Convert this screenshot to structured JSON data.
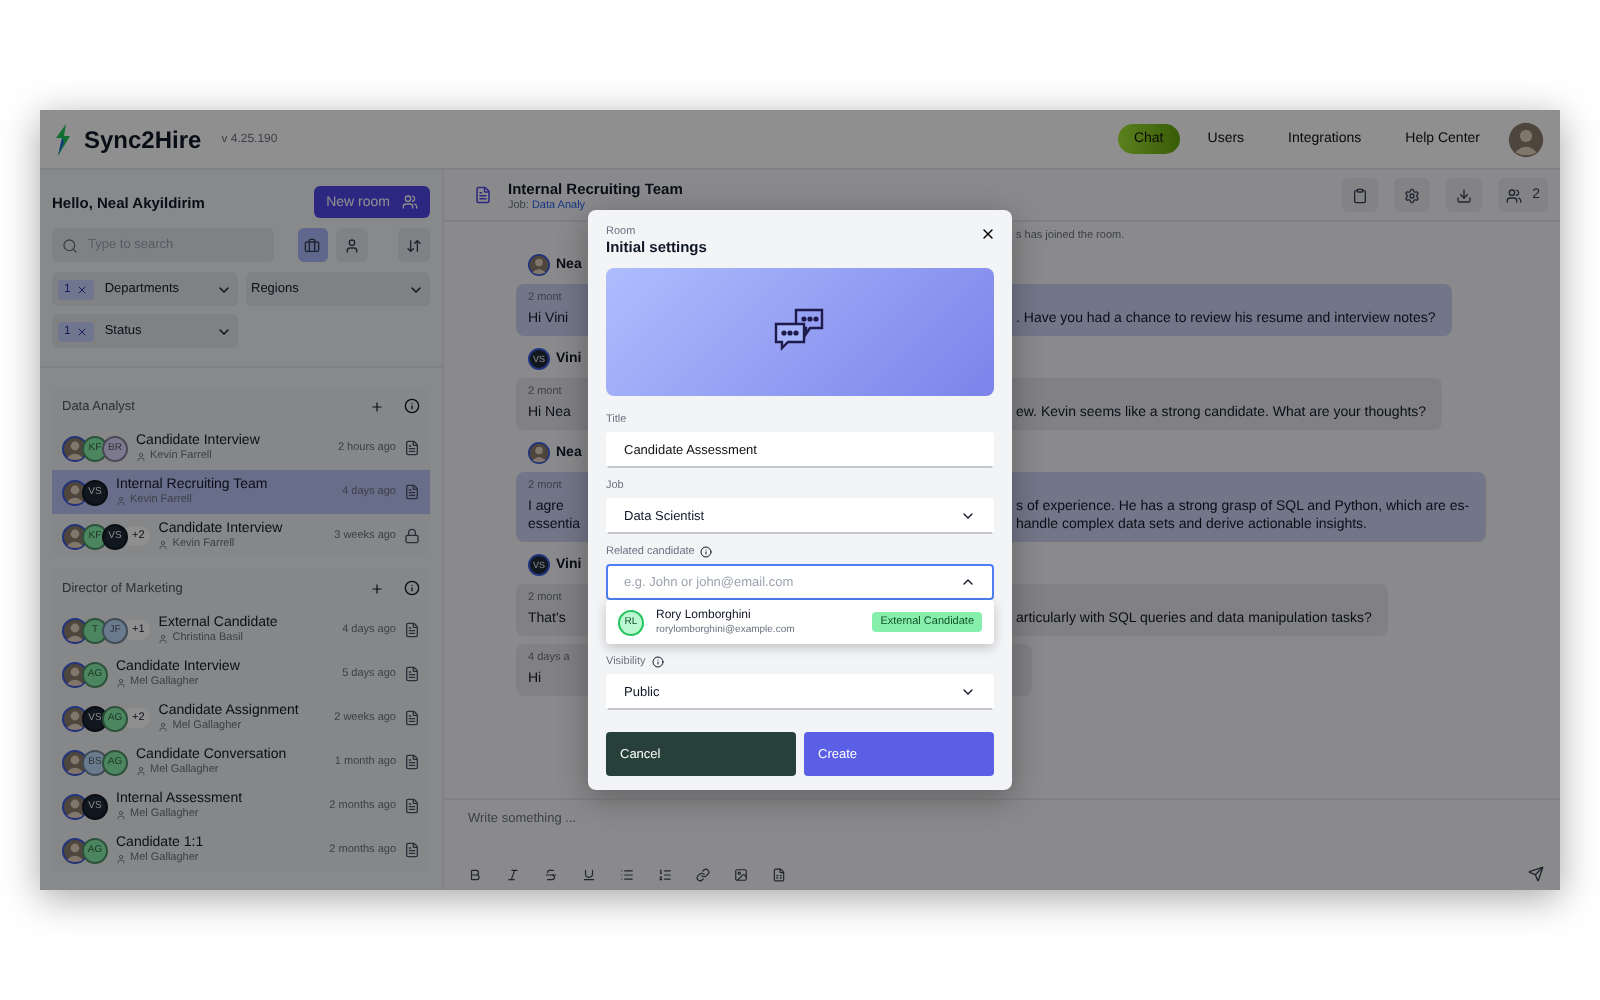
{
  "header": {
    "logo": "Sync2Hire",
    "version": "v 4.25.190",
    "nav": [
      {
        "label": "Chat",
        "selected": true
      },
      {
        "label": "Users",
        "selected": false
      },
      {
        "label": "Integrations",
        "selected": false
      },
      {
        "label": "Help Center",
        "selected": false
      }
    ]
  },
  "sidebar": {
    "greeting": "Hello, Neal Akyildirim",
    "new_room": "New room",
    "search": {
      "placeholder": "Type to search"
    },
    "view_toggles": [
      {
        "kind": "briefcase",
        "selected": true
      },
      {
        "kind": "person",
        "selected": false
      }
    ],
    "filters": [
      {
        "count": "1",
        "label": "Departments"
      },
      {
        "label": "Regions"
      },
      {
        "count": "1",
        "label": "Status"
      }
    ],
    "groups": [
      {
        "name": "Data Analyst",
        "rooms": [
          {
            "title": "Candidate Interview",
            "owner": "Kevin Farrell",
            "time": "2 hours ago",
            "locked": false,
            "selected": false,
            "avatars": [
              {
                "kind": "photo"
              },
              {
                "kind": "initials",
                "text": "KF",
                "color": "#4b8660"
              },
              {
                "kind": "initials",
                "text": "BR",
                "color": "#7c788e"
              }
            ]
          },
          {
            "title": "Internal Recruiting Team",
            "owner": "Kevin Farrell",
            "time": "4 days ago",
            "locked": false,
            "selected": true,
            "avatars": [
              {
                "kind": "photo"
              },
              {
                "kind": "initials",
                "text": "VS",
                "color": "#11171f"
              }
            ]
          },
          {
            "title": "Candidate Interview",
            "owner": "Kevin Farrell",
            "time": "3 weeks ago",
            "locked": true,
            "selected": false,
            "extra": "+2",
            "avatars": [
              {
                "kind": "photo"
              },
              {
                "kind": "initials",
                "text": "KF",
                "color": "#4b8660"
              },
              {
                "kind": "initials",
                "text": "VS",
                "color": "#11171f"
              }
            ]
          }
        ]
      },
      {
        "name": "Director of Marketing",
        "rooms": [
          {
            "title": "External Candidate",
            "owner": "Christina Basil",
            "time": "4 days ago",
            "locked": false,
            "selected": false,
            "extra": "+1",
            "avatars": [
              {
                "kind": "photo"
              },
              {
                "kind": "initials",
                "text": "T",
                "color": "#4b8660"
              },
              {
                "kind": "initials",
                "text": "JF",
                "color": "#6b7b8e"
              }
            ]
          },
          {
            "title": "Candidate Interview",
            "owner": "Mel Gallagher",
            "time": "5 days ago",
            "locked": false,
            "selected": false,
            "avatars": [
              {
                "kind": "photo"
              },
              {
                "kind": "initials",
                "text": "AG",
                "color": "#4b8660"
              }
            ]
          },
          {
            "title": "Candidate Assignment",
            "owner": "Mel Gallagher",
            "time": "2 weeks ago",
            "locked": false,
            "selected": false,
            "extra": "+2",
            "avatars": [
              {
                "kind": "photo"
              },
              {
                "kind": "initials",
                "text": "VS",
                "color": "#11171f"
              },
              {
                "kind": "initials",
                "text": "AG",
                "color": "#4b8660"
              }
            ]
          },
          {
            "title": "Candidate Conversation",
            "owner": "Mel Gallagher",
            "time": "1 month ago",
            "locked": false,
            "selected": false,
            "avatars": [
              {
                "kind": "photo"
              },
              {
                "kind": "initials",
                "text": "BS",
                "color": "#6b7b8e"
              },
              {
                "kind": "initials",
                "text": "AG",
                "color": "#4b8660"
              }
            ]
          },
          {
            "title": "Internal Assessment",
            "owner": "Mel Gallagher",
            "time": "2 months ago",
            "locked": false,
            "selected": false,
            "avatars": [
              {
                "kind": "photo"
              },
              {
                "kind": "initials",
                "text": "VS",
                "color": "#11171f"
              }
            ]
          },
          {
            "title": "Candidate 1:1",
            "owner": "Mel Gallagher",
            "time": "2 months ago",
            "locked": false,
            "selected": false,
            "avatars": [
              {
                "kind": "photo"
              },
              {
                "kind": "initials",
                "text": "AG",
                "color": "#4b8660"
              }
            ]
          }
        ]
      }
    ]
  },
  "room": {
    "title": "Internal Recruiting Team",
    "job_label": "Job:",
    "job_link": "Data Analy",
    "participants": "2"
  },
  "messages": [
    {
      "kind": "system",
      "right": "s has joined the room."
    },
    {
      "kind": "author",
      "name": "Nea"
    },
    {
      "kind": "bubble",
      "own": true,
      "time": "2 mont",
      "left": [
        "Hi Vini"
      ],
      "right": [
        ". Have you had a chance to review his resume and interview notes?"
      ]
    },
    {
      "kind": "author",
      "initials": "VS",
      "name": "Vini"
    },
    {
      "kind": "bubble",
      "own": false,
      "time": "2 mont",
      "left": [
        "Hi Nea"
      ],
      "right": [
        "ew. Kevin seems like a strong candidate. What are your thoughts?"
      ]
    },
    {
      "kind": "author",
      "name": "Nea"
    },
    {
      "kind": "bubble",
      "own": true,
      "time": "2 mont",
      "left": [
        "I agre",
        "essentia"
      ],
      "right": [
        "s of experience. He has a strong grasp of SQL and Python, which are es-",
        "handle complex data sets and derive actionable insights."
      ]
    },
    {
      "kind": "author",
      "initials": "VS",
      "name": "Vini"
    },
    {
      "kind": "bubble",
      "own": false,
      "time": "2 mont",
      "left": [
        "That's"
      ],
      "right": [
        "articularly with SQL queries and data manipulation tasks?"
      ]
    },
    {
      "kind": "bubble",
      "own": false,
      "time": "4 days a",
      "left": [
        "Hi"
      ]
    }
  ],
  "composer": {
    "placeholder": "Write something ..."
  },
  "modal": {
    "eyebrow": "Room",
    "title": "Initial settings",
    "fields": [
      {
        "kind": "text",
        "label": "Title",
        "value": "Candidate Assessment"
      },
      {
        "kind": "select",
        "label": "Job",
        "value": "Data Scientist"
      },
      {
        "kind": "combo",
        "label": "Related candidate",
        "info": true,
        "placeholder": "e.g. John or john@email.com",
        "expanded": true,
        "options": [
          {
            "initials": "RL",
            "name": "Rory Lomborghini",
            "email": "rorylomborghini@example.com",
            "tag": "External Candidate"
          }
        ]
      },
      {
        "kind": "select",
        "label": "Visibility",
        "info": true,
        "value": "Public"
      }
    ],
    "buttons": [
      {
        "kind": "secondary",
        "label": "Cancel"
      },
      {
        "kind": "primary",
        "label": "Create"
      }
    ]
  }
}
